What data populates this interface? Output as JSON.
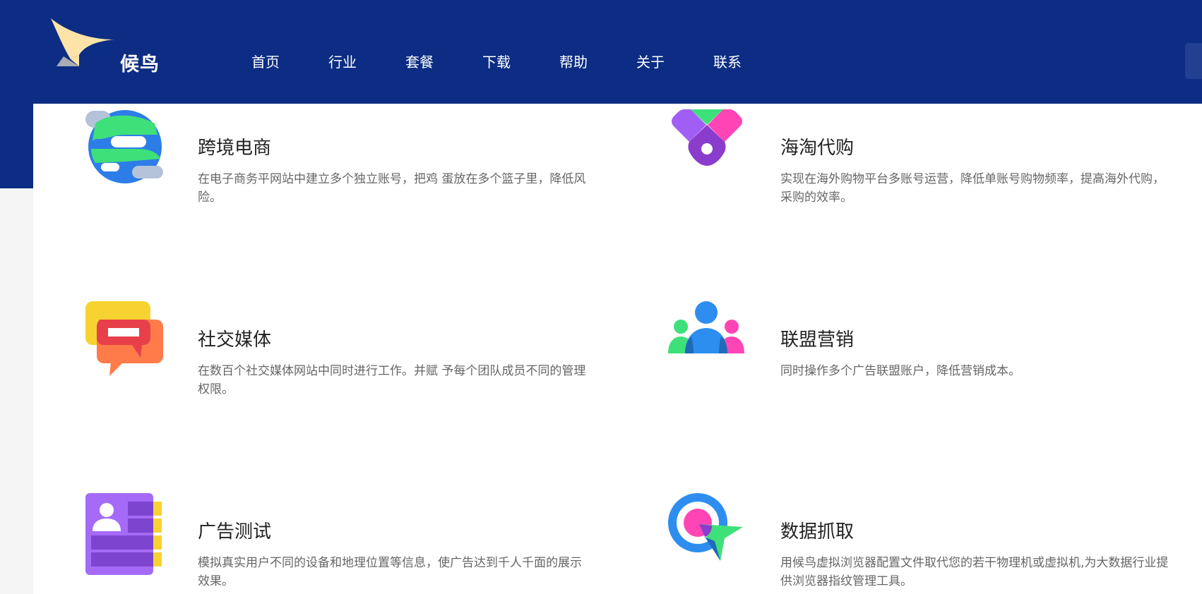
{
  "brand": {
    "name": "候鸟"
  },
  "nav": {
    "items": [
      {
        "label": "首页"
      },
      {
        "label": "行业"
      },
      {
        "label": "套餐"
      },
      {
        "label": "下载"
      },
      {
        "label": "帮助"
      },
      {
        "label": "关于"
      },
      {
        "label": "联系"
      }
    ]
  },
  "colors": {
    "header_bg": "#0c2d83",
    "panel_bg": "#ffffff",
    "title_text": "#222222",
    "desc_text": "#666666"
  },
  "cards": [
    {
      "icon": "globe-icon",
      "title": "跨境电商",
      "desc": "在电子商务平网站中建立多个独立账号，把鸡 蛋放在多个篮子里，降低风险。"
    },
    {
      "icon": "location-pin-icon",
      "title": "海淘代购",
      "desc": "实现在海外购物平台多账号运营，降低单账号购物频率，提高海外代购，采购的效率。"
    },
    {
      "icon": "chat-bubble-icon",
      "title": "社交媒体",
      "desc": "在数百个社交媒体网站中同时进行工作。并赋 予每个团队成员不同的管理权限。"
    },
    {
      "icon": "team-icon",
      "title": "联盟营销",
      "desc": "同时操作多个广告联盟账户，降低营销成本。"
    },
    {
      "icon": "profile-card-icon",
      "title": "广告测试",
      "desc": "模拟真实用户不同的设备和地理位置等信息，使广告达到千人千面的展示效果。"
    },
    {
      "icon": "target-pointer-icon",
      "title": "数据抓取",
      "desc": "用候鸟虚拟浏览器配置文件取代您的若干物理机或虚拟机,为大数据行业提供浏览器指纹管理工具。"
    }
  ]
}
